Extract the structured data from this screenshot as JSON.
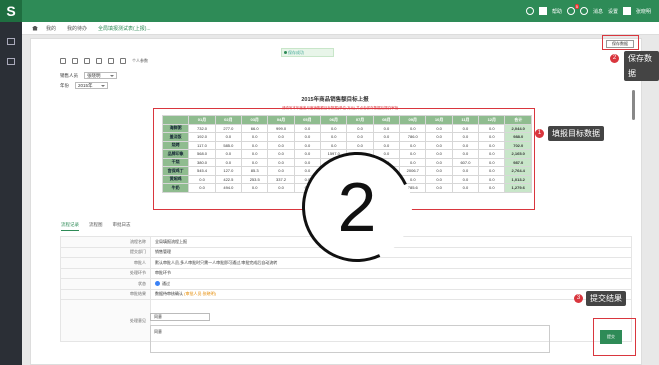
{
  "app": {
    "logo": "S"
  },
  "topbar": {
    "items": [
      "帮助",
      "消息",
      "设置",
      "张晓明"
    ],
    "notify_count": "5"
  },
  "breadcrumb": [
    "我的",
    "我的待办",
    "全局填报测试表(上报)..."
  ],
  "main": {
    "toast": "保存成功",
    "save_button": "保存数据",
    "toolbar_label": "个人参数",
    "filters": [
      {
        "label": "销售人员",
        "value": "张晓明"
      },
      {
        "label": "年份",
        "value": "2015年"
      }
    ],
    "report_title": "2015年商品销售额目标上报",
    "report_sub": "请填写本年度各月度销售额目标数据(单位:万元),并点击保存数据后提交审批",
    "table": {
      "columns": [
        "",
        "01月",
        "02月",
        "03月",
        "04月",
        "05月",
        "06月",
        "07月",
        "08月",
        "09月",
        "10月",
        "11月",
        "12月",
        "合计"
      ],
      "rows": [
        {
          "name": "海鲜粥",
          "values": [
            "732.0",
            "277.0",
            "66.0",
            "999.0",
            "0.0",
            "0.0",
            "0.0",
            "0.0",
            "0.0",
            "0.0",
            "0.0",
            "0.0",
            "2,044.0"
          ]
        },
        {
          "name": "盖浇饭",
          "values": [
            "192.0",
            "0.0",
            "0.0",
            "0.0",
            "0.0",
            "0.0",
            "0.0",
            "0.0",
            "786.0",
            "0.0",
            "0.0",
            "0.0",
            "988.0"
          ]
        },
        {
          "name": "烧烤",
          "values": [
            "117.0",
            "585.0",
            "0.0",
            "0.0",
            "0.0",
            "0.0",
            "0.0",
            "0.0",
            "0.0",
            "0.0",
            "0.0",
            "0.0",
            "702.0"
          ]
        },
        {
          "name": "品牌印象",
          "values": [
            "568.0",
            "0.0",
            "0.0",
            "0.0",
            "0.0",
            "1597.0",
            "0.0",
            "0.0",
            "0.0",
            "0.0",
            "0.0",
            "0.0",
            "2,165.0"
          ]
        },
        {
          "name": "干烧",
          "values": [
            "380.0",
            "0.0",
            "0.0",
            "0.0",
            "0.0",
            "0.0",
            "0.0",
            "0.0",
            "0.0",
            "0.0",
            "607.0",
            "0.0",
            "987.0"
          ]
        },
        {
          "name": "宫保鸡丁",
          "values": [
            "545.4",
            "127.0",
            "85.3",
            "0.0",
            "0.0",
            "0.0",
            "0.0",
            "0.0",
            "2006.7",
            "0.0",
            "0.0",
            "0.0",
            "2,764.4"
          ]
        },
        {
          "name": "黄焖鸡",
          "values": [
            "0.0",
            "422.5",
            "253.5",
            "337.2",
            "0.0",
            "0.0",
            "0.0",
            "0.0",
            "0.0",
            "0.0",
            "0.0",
            "0.0",
            "1,013.2"
          ]
        },
        {
          "name": "牛奶",
          "values": [
            "0.0",
            "494.0",
            "0.0",
            "0.0",
            "0.0",
            "0.0",
            "0.0",
            "0.0",
            "785.6",
            "0.0",
            "0.0",
            "0.0",
            "1,279.6"
          ]
        }
      ]
    },
    "tabs": [
      "流程记录",
      "流程图",
      "审批日志"
    ],
    "info": [
      {
        "label": "流程名称",
        "value": "全局填报流程上报"
      },
      {
        "label": "提交部门",
        "value": "销售管理"
      },
      {
        "label": "审批人",
        "value": "默认审批人员,多人审批时只需一人审批即可通过,审批完成后自动流转"
      },
      {
        "label": "处理环节",
        "value": "审批环节"
      },
      {
        "label": "状态",
        "value": "通过"
      },
      {
        "label": "审批结果",
        "value": "数据待审核确认",
        "highlight": "(审批人员:张晓明)"
      }
    ],
    "opinion_label": "处理意见",
    "opinion_select": "同意",
    "opinion_text": "同意",
    "submit_button": "提交"
  },
  "callouts": [
    {
      "num": "1",
      "text": "填报目标数据"
    },
    {
      "num": "2",
      "text": "保存数据"
    },
    {
      "num": "3",
      "text": "提交结果"
    }
  ],
  "big_step_number": "2"
}
